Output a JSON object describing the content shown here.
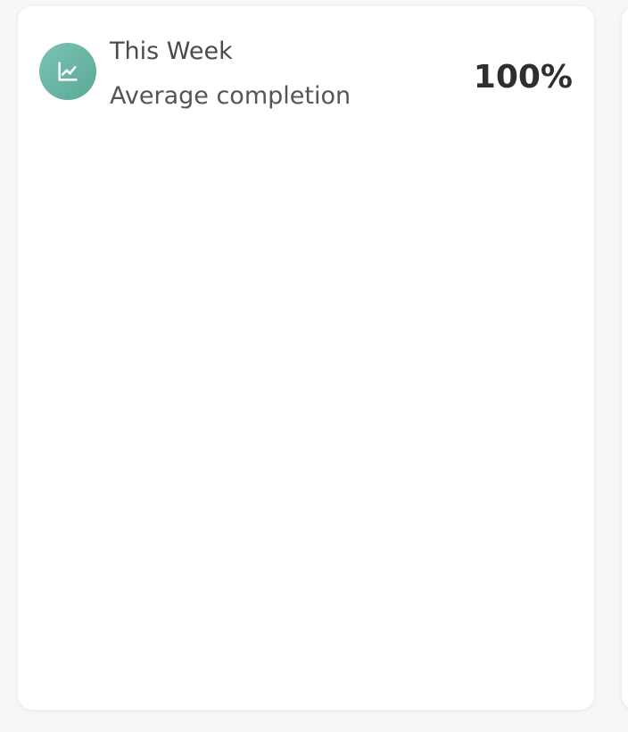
{
  "card": {
    "title": "This Week",
    "subtitle": "Average completion",
    "value": "100%",
    "icon": "line-chart-icon",
    "accent_color": "#6ab7a6",
    "background_color": "#ffffff"
  }
}
